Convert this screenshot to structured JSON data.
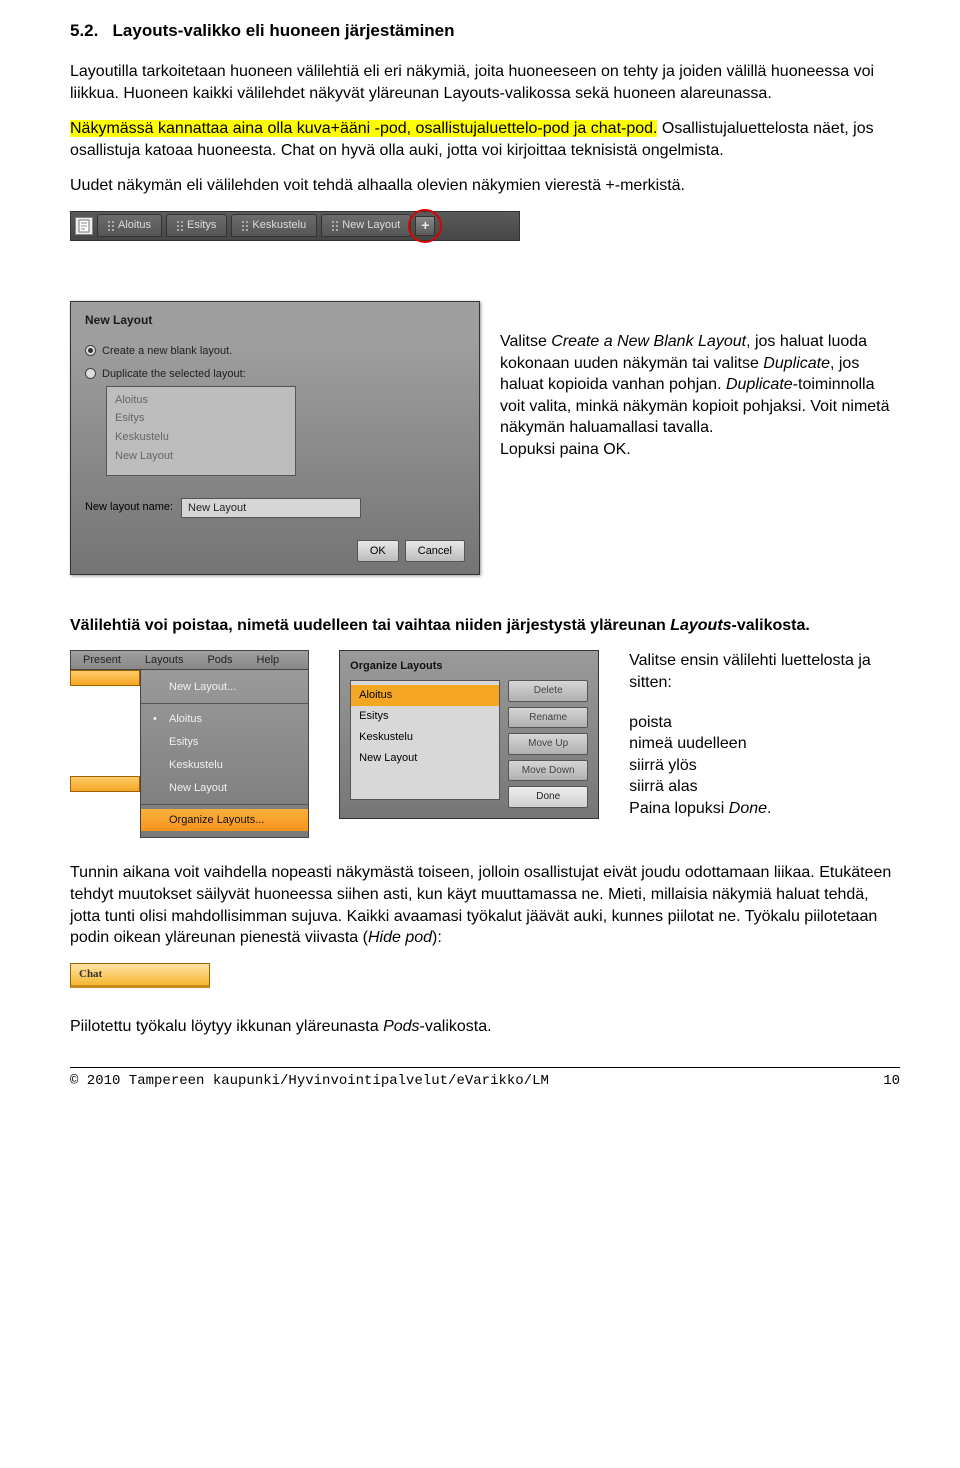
{
  "section": {
    "number": "5.2.",
    "title": "Layouts-valikko eli huoneen järjestäminen"
  },
  "p1": "Layoutilla tarkoitetaan huoneen välilehtiä eli eri näkymiä, joita huoneeseen on tehty ja joiden välillä huoneessa voi liikkua. Huoneen kaikki välilehdet näkyvät yläreunan Layouts-valikossa sekä huoneen alareunassa.",
  "p2_hl": "Näkymässä kannattaa aina olla kuva+ääni -pod, osallistujaluettelo-pod ja chat-pod.",
  "p2_rest": " Osallistujaluettelosta näet, jos osallistuja katoaa huoneesta. Chat on hyvä olla auki, jotta voi kirjoittaa teknisistä ongelmista.",
  "p3": "Uudet näkymän eli välilehden voit tehdä alhaalla olevien näkymien vierestä +-merkistä.",
  "tabs": {
    "t1": "Aloitus",
    "t2": "Esitys",
    "t3": "Keskustelu",
    "t4": "New Layout"
  },
  "dialog": {
    "title": "New Layout",
    "opt1": "Create a new blank layout.",
    "opt2": "Duplicate the selected layout:",
    "list": {
      "i1": "Aloitus",
      "i2": "Esitys",
      "i3": "Keskustelu",
      "i4": "New Layout"
    },
    "name_label": "New layout name:",
    "name_value": "New Layout",
    "ok": "OK",
    "cancel": "Cancel"
  },
  "right1a": "Valitse ",
  "right1b": "Create a New Blank Layout",
  "right1c": ", jos haluat luoda kokonaan uuden näkymän tai valitse ",
  "right1d": "Duplicate",
  "right1e": ", jos haluat kopioida vanhan pohjan. ",
  "right1f": "Duplicate",
  "right1g": "-toiminnolla voit valita, minkä näkymän kopioit pohjaksi. Voit nimetä näkymän haluamallasi tavalla.",
  "right1h": "Lopuksi paina OK.",
  "p4a": "Välilehtiä voi poistaa, nimetä uudelleen tai vaihtaa niiden järjestystä yläreunan ",
  "p4b": "Layouts",
  "p4c": "-valikosta.",
  "menubar": {
    "m1": "Present",
    "m2": "Layouts",
    "m3": "Pods",
    "m4": "Help"
  },
  "dropdown": {
    "i1": "New Layout...",
    "i2": "Aloitus",
    "i3": "Esitys",
    "i4": "Keskustelu",
    "i5": "New Layout",
    "i6": "Organize Layouts..."
  },
  "org": {
    "title": "Organize Layouts",
    "list": {
      "i1": "Aloitus",
      "i2": "Esitys",
      "i3": "Keskustelu",
      "i4": "New Layout"
    },
    "b1": "Delete",
    "b2": "Rename",
    "b3": "Move Up",
    "b4": "Move Down",
    "b5": "Done"
  },
  "sidetext": {
    "s0": "Valitse ensin välilehti luettelosta ja sitten:",
    "s1": "poista",
    "s2": "nimeä uudelleen",
    "s3": "siirrä ylös",
    "s4": "siirrä alas",
    "s5a": "Paina lopuksi ",
    "s5b": "Done",
    "s5c": "."
  },
  "p5": "Tunnin aikana voit vaihdella nopeasti näkymästä toiseen, jolloin osallistujat eivät joudu odottamaan liikaa. Etukäteen tehdyt muutokset säilyvät huoneessa siihen asti, kun käyt muuttamassa ne. Mieti, millaisia näkymiä haluat tehdä, jotta tunti olisi mahdollisimman sujuva. Kaikki avaamasi työkalut jäävät auki, kunnes piilotat ne. Työkalu piilotetaan podin oikean yläreunan pienestä viivasta (",
  "p5b": "Hide pod",
  "p5c": "):",
  "chat_label": "Chat",
  "p6a": "Piilotettu työkalu löytyy ikkunan yläreunasta ",
  "p6b": "Pods",
  "p6c": "-valikosta.",
  "footer": {
    "left": "© 2010 Tampereen kaupunki/Hyvinvointipalvelut/eVarikko/LM",
    "right": "10"
  }
}
